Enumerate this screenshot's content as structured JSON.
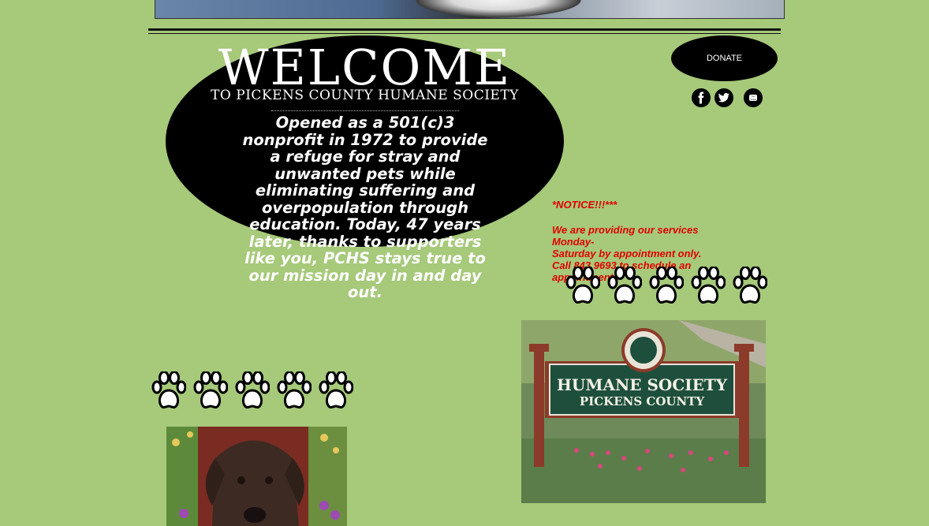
{
  "header": {
    "banner_label": "Top photo banner"
  },
  "hero": {
    "title": "WELCOME",
    "subtitle": "TO PICKENS COUNTY HUMANE SOCIETY",
    "body": "Opened as a 501(c)3 nonprofit in 1972 to provide a refuge for stray and unwanted pets while eliminating suffering and overpopulation through education. Today, 47 years later, thanks to supporters like you, PCHS stays true to our mission day in and day out."
  },
  "donate": {
    "label": "DONATE"
  },
  "social": [
    {
      "name": "facebook-icon"
    },
    {
      "name": "twitter-icon"
    },
    {
      "name": "youtube-icon"
    }
  ],
  "notice": {
    "heading": "*NOTICE!!!***",
    "lines": [
      "We are providing our services Monday-",
      "Saturday by appointment only.",
      "Call 843 9693 to schedule an appointment"
    ]
  },
  "sign": {
    "line1": "HUMANE SOCIETY",
    "line2": "PICKENS COUNTY"
  },
  "colors": {
    "background": "#a6c97a",
    "notice_text": "#e10000",
    "oval": "#000000"
  }
}
